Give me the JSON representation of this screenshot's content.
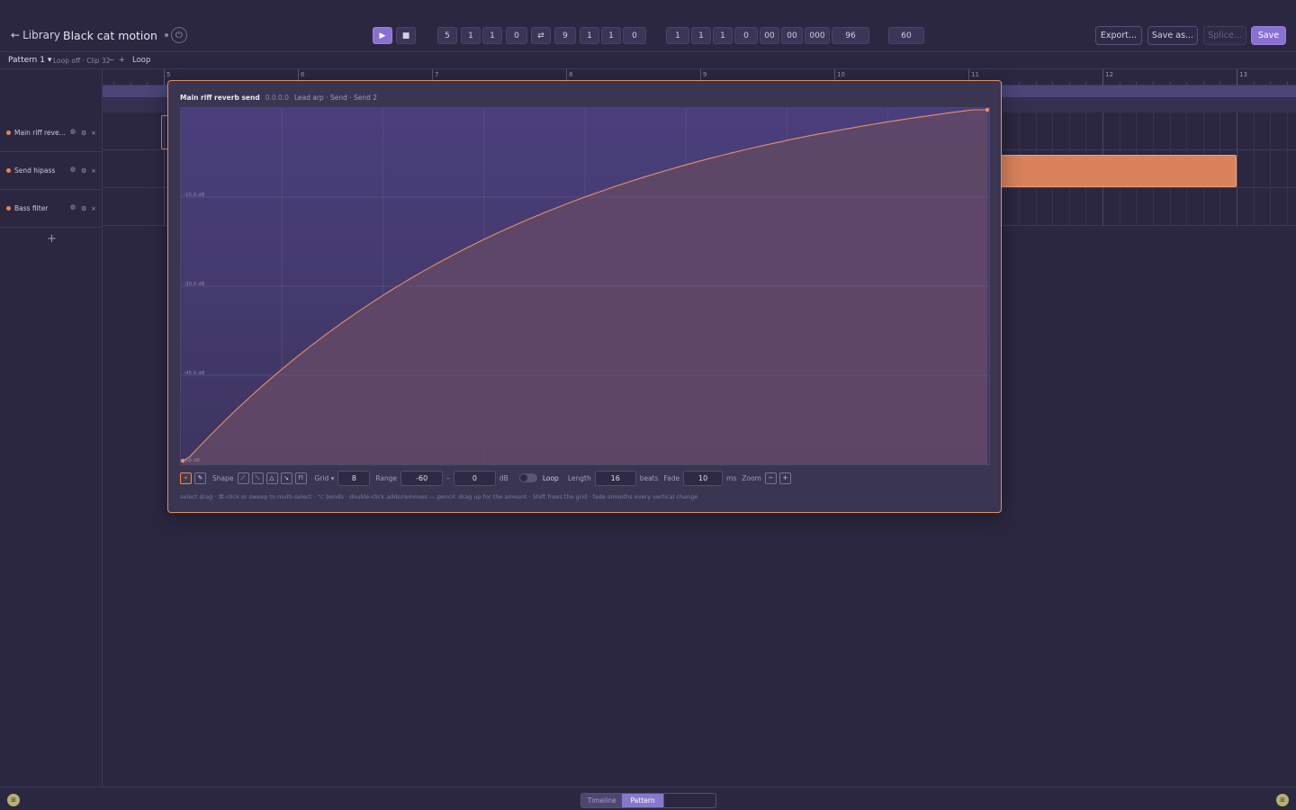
{
  "header": {
    "back_label": "Library",
    "back_arrow": "←",
    "title": "Black cat motion",
    "power_icon": "⏻"
  },
  "transport": {
    "play_icon": "▶",
    "stop_icon": "■",
    "loop_icon": "⇄",
    "loop_start": [
      "5",
      "1",
      "1",
      "0"
    ],
    "loop_end": [
      "9",
      "1",
      "1",
      "0"
    ],
    "position": [
      "1",
      "1",
      "1",
      "0",
      "00",
      "00",
      "000"
    ],
    "ppq": "96",
    "tempo": "60"
  },
  "actions": {
    "export": "Export...",
    "save_as": "Save as...",
    "splice": "Splice...",
    "save": "Save"
  },
  "subbar": {
    "pattern": "Pattern 1 ▾",
    "loop_info": "Loop off · Clip 32",
    "minus": "−",
    "plus": "+",
    "loop": "Loop"
  },
  "tracks": [
    {
      "name": "Main riff reverb send",
      "color": "#e6865a"
    },
    {
      "name": "Send hipass",
      "color": "#e6865a"
    },
    {
      "name": "Bass filter",
      "color": "#e6865a"
    }
  ],
  "track_icons": {
    "mute": "◍",
    "settings": "⚙",
    "remove": "×"
  },
  "add_track": "+",
  "ruler": {
    "bars": [
      "5",
      "6",
      "7",
      "8",
      "9",
      "10",
      "11",
      "12",
      "13"
    ]
  },
  "editor": {
    "title": "Main riff reverb send",
    "time": "0.0.0.0",
    "path": "Lead arp · Send · Send 2",
    "y_labels": [
      "-15.0 dB",
      "-30.0 dB",
      "-45.0 dB",
      "-60 dB"
    ],
    "curve": {
      "shape": "exponential-rise",
      "from_db": -60,
      "to_db": 0
    },
    "tools": {
      "select_icon": "⌖",
      "pencil_icon": "✎",
      "shape_label": "Shape",
      "shape_icons": [
        "⟋",
        "⟍",
        "△",
        "↘",
        "⊓"
      ],
      "grid_label": "Grid ▾",
      "grid_value": "8",
      "range_label": "Range",
      "range_min": "-60",
      "range_sep": "–",
      "range_max": "0",
      "range_unit": "dB",
      "loop_label": "Loop",
      "length_label": "Length",
      "length_value": "16",
      "length_unit": "beats",
      "fade_label": "Fade",
      "fade_value": "10",
      "fade_unit": "ms",
      "zoom_label": "Zoom",
      "zoom_out": "−",
      "zoom_in": "+"
    },
    "hint": "select drag · ⌘-click or sweep to multi-select · ⌥ bends · double-click adds/removes — pencil: drag up for the amount · Shift frees the grid · fade smooths every vertical change"
  },
  "bottom": {
    "tab_timeline": "Timeline",
    "tab_pattern": "Pattern",
    "corner_icon": "⊞"
  },
  "colors": {
    "accent": "#8b6fd1",
    "automation": "#e6865a",
    "background": "#2b2740"
  }
}
